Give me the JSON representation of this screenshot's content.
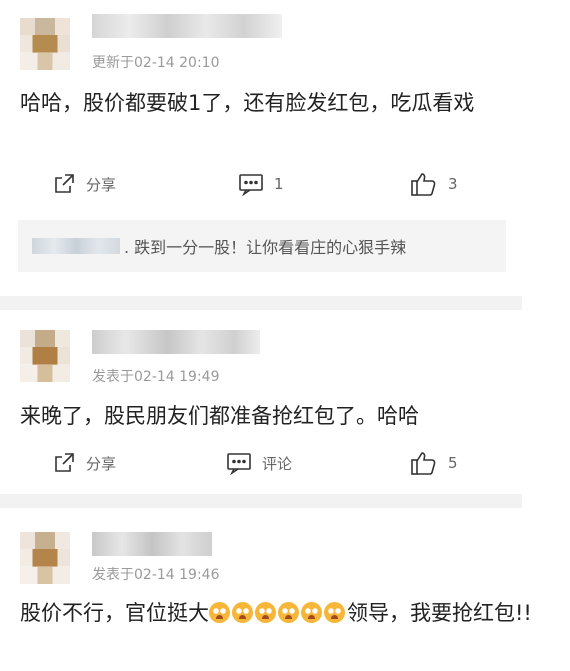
{
  "comments": [
    {
      "timestamp": "更新于02-14 20:10",
      "text": "哈哈，股价都要破1了，还有脸发红包，吃瓜看戏",
      "actions": {
        "share": "分享",
        "comment": "1",
        "like": "3"
      },
      "reply": {
        "text": ". 跌到一分一股！让你看看庄的心狠手辣"
      }
    },
    {
      "timestamp": "发表于02-14 19:49",
      "text": "来晚了，股民朋友们都准备抢红包了。哈哈",
      "actions": {
        "share": "分享",
        "comment": "评论",
        "like": "5"
      }
    },
    {
      "timestamp": "发表于02-14 19:46",
      "text_before": "股价不行，官位挺大",
      "emoji_count": 6,
      "text_after": "领导，我要抢红包!!"
    }
  ]
}
